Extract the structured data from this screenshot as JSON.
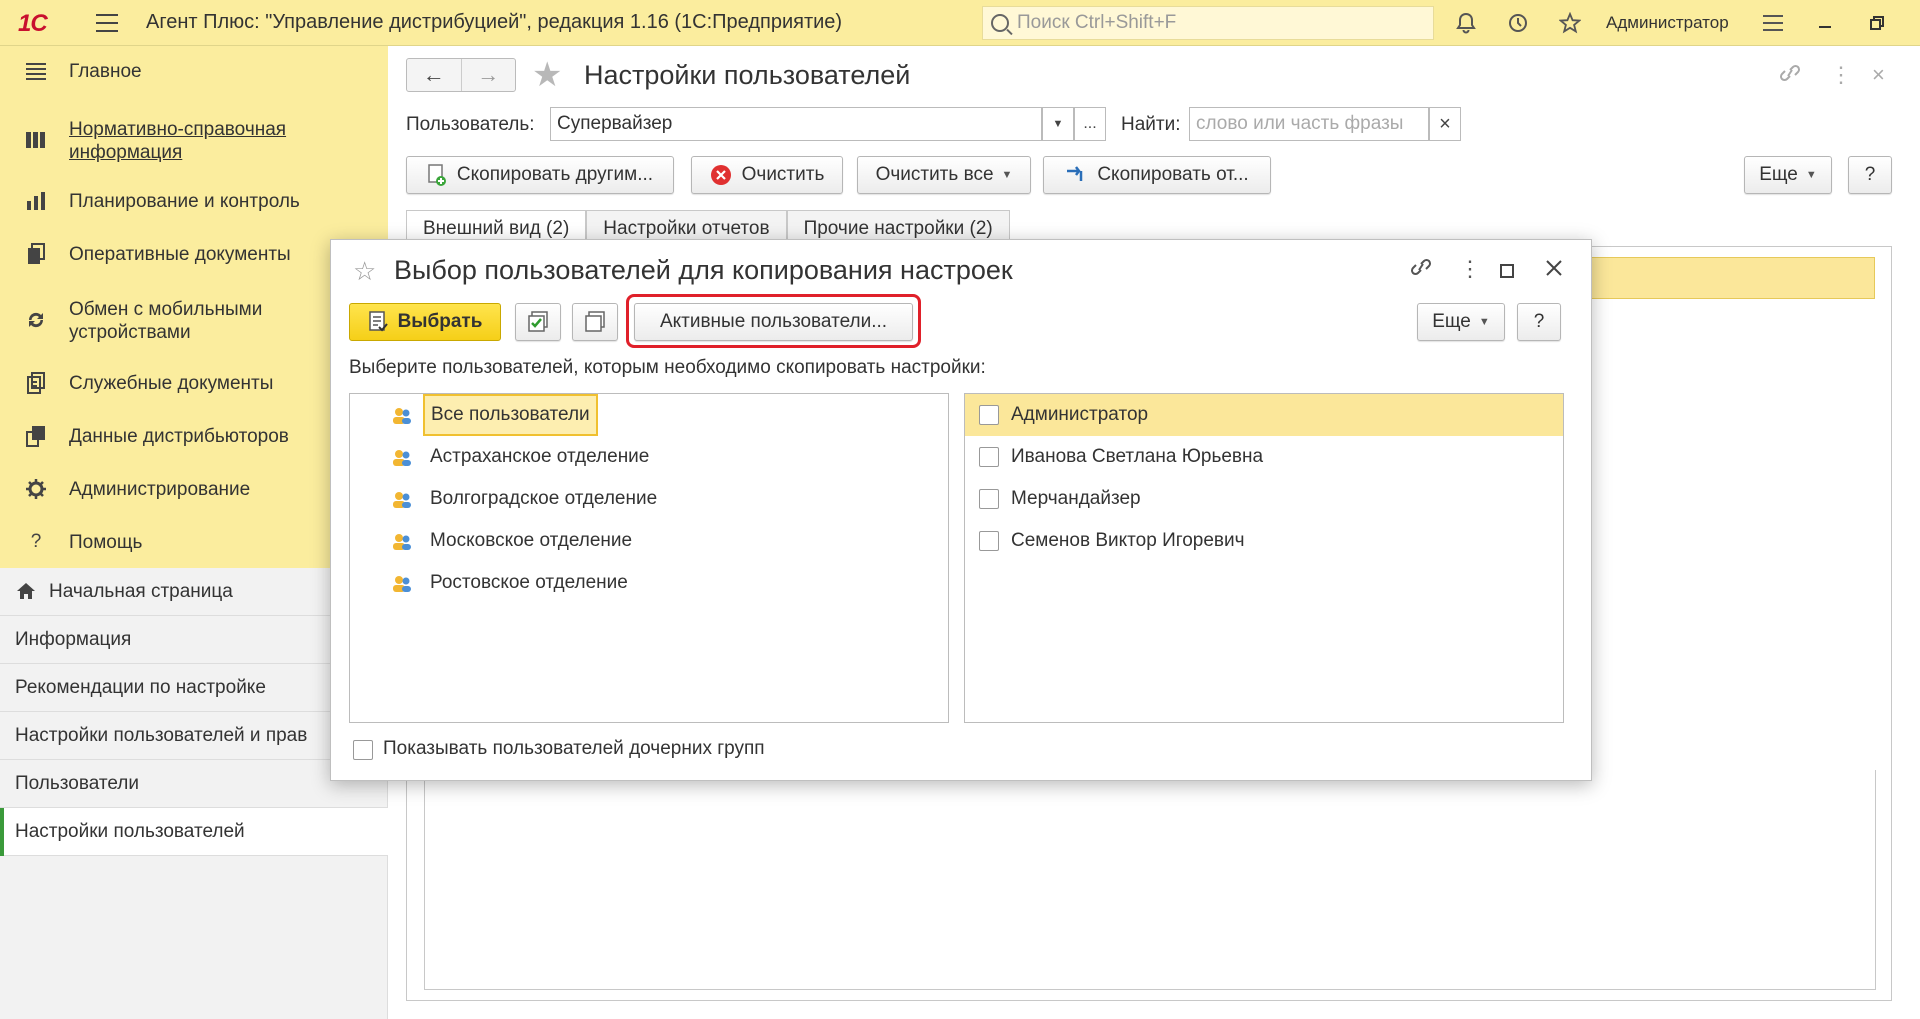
{
  "app": {
    "logo": "1С",
    "title": "Агент Плюс: \"Управление дистрибуцией\", редакция 1.16  (1С:Предприятие)",
    "search_placeholder": "Поиск Ctrl+Shift+F",
    "user": "Администратор"
  },
  "sidebar": {
    "items": [
      {
        "label": "Главное",
        "icon": "menu-lines-icon"
      },
      {
        "label": "Нормативно-справочная информация",
        "line1": "Нормативно-справочная",
        "line2": "информация",
        "icon": "catalog-icon"
      },
      {
        "label": "Планирование и контроль",
        "icon": "bar-chart-icon"
      },
      {
        "label": "Оперативные документы",
        "icon": "documents-icon"
      },
      {
        "label": "Обмен с мобильными устройствами",
        "line1": "Обмен с мобильными",
        "line2": "устройствами",
        "icon": "sync-icon"
      },
      {
        "label": "Служебные документы",
        "icon": "service-documents-icon"
      },
      {
        "label": "Данные дистрибьюторов",
        "icon": "distributor-data-icon"
      },
      {
        "label": "Администрирование",
        "icon": "gear-icon"
      },
      {
        "label": "Помощь",
        "icon": "question-icon"
      }
    ]
  },
  "open_windows": [
    {
      "label": "Начальная страница"
    },
    {
      "label": "Информация"
    },
    {
      "label": "Рекомендации по настройке"
    },
    {
      "label": "Настройки пользователей и прав"
    },
    {
      "label": "Пользователи"
    },
    {
      "label": "Настройки пользователей"
    }
  ],
  "form": {
    "title": "Настройки пользователей",
    "user_label": "Пользователь:",
    "user_value": "Супервайзер",
    "user_more": "...",
    "find_label": "Найти:",
    "find_placeholder": "слово или часть фразы",
    "clear_symbol": "×",
    "buttons": {
      "copy_to_others": "Скопировать другим...",
      "clear": "Очистить",
      "clear_all": "Очистить все",
      "copy_from": "Скопировать от...",
      "more": "Еще",
      "help": "?"
    },
    "tabs": [
      {
        "label": "Внешний вид (2)"
      },
      {
        "label": "Настройки отчетов"
      },
      {
        "label": "Прочие настройки (2)"
      }
    ]
  },
  "modal": {
    "title": "Выбор пользователей для копирования настроек",
    "select_button": "Выбрать",
    "active_users_button": "Активные пользователи...",
    "more": "Еще",
    "help": "?",
    "hint": "Выберите пользователей, которым необходимо скопировать настройки:",
    "groups": [
      {
        "label": "Все пользователи",
        "selected": true
      },
      {
        "label": "Астраханское отделение"
      },
      {
        "label": "Волгоградское отделение"
      },
      {
        "label": "Московское отделение"
      },
      {
        "label": "Ростовское отделение"
      }
    ],
    "users": [
      {
        "label": "Администратор",
        "selected": true
      },
      {
        "label": "Иванова Светлана Юрьевна"
      },
      {
        "label": "Мерчандайзер"
      },
      {
        "label": "Семенов Виктор Игоревич"
      }
    ],
    "show_child_groups": "Показывать пользователей дочерних групп"
  },
  "colors": {
    "topbar": "#fbed9e",
    "accent_yellow": "#f5cf18",
    "highlight_red": "#e0202a",
    "active_window_marker": "#3a9a3a"
  }
}
